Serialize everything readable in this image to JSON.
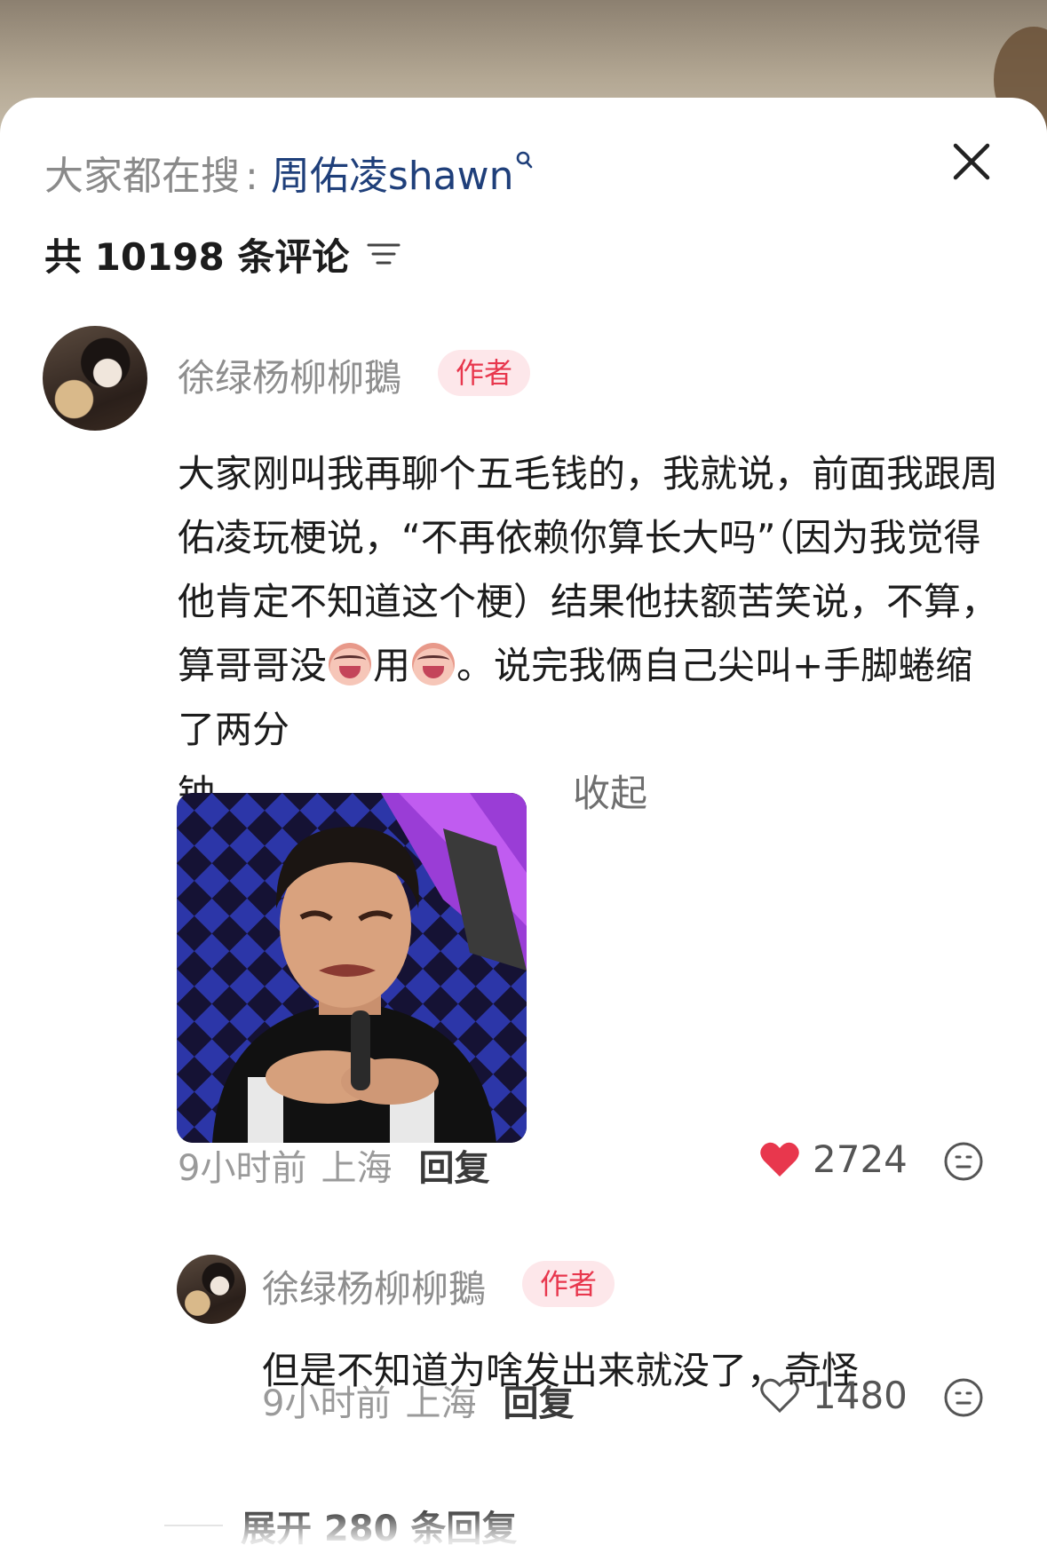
{
  "search": {
    "prefix": "大家都在搜",
    "separator": ":",
    "term": "周佑凌shawn"
  },
  "comments_header": {
    "count_label": "共 10198 条评论"
  },
  "comment": {
    "username": "徐绿杨柳柳鵝",
    "badge": "作者",
    "text_part1": "大家刚叫我再聊个五毛钱的，我就说，前面我跟周佑凌玩梗说，“不再依赖你算长大吗”（因为我觉得他肯定不知道这个梗）结果他扶额苦笑说，不算，算哥哥没",
    "text_part2": "用",
    "text_part3": "。说完我俩自己尖叫+手脚蜷缩了两分",
    "text_part4": "钟。",
    "text_dots": "。。。。。。。。。",
    "collapse": "收起",
    "time": "9小时前",
    "location": "上海",
    "reply": "回复",
    "likes": "2724",
    "liked": true
  },
  "reply_comment": {
    "username": "徐绿杨柳柳鵝",
    "badge": "作者",
    "text": "但是不知道为啥发出来就没了，奇怪",
    "time": "9小时前",
    "location": "上海",
    "reply": "回复",
    "likes": "1480",
    "liked": false
  },
  "expand": {
    "label": "展开 280 条回复"
  },
  "colors": {
    "accent_red": "#e8374d",
    "search_term": "#1f3f7a",
    "badge_bg": "#fde7ea"
  },
  "icons": {
    "close": "close-icon",
    "sort": "sort-icon",
    "search_mini": "search-icon",
    "heart_filled": "heart-filled-icon",
    "heart_outline": "heart-outline-icon",
    "emoji_reaction": "smile-icon"
  }
}
